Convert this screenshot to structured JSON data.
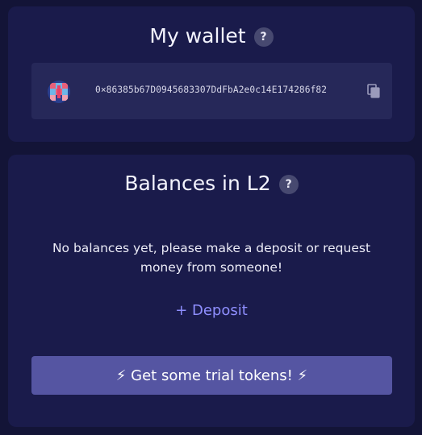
{
  "wallet": {
    "title": "My wallet",
    "help_glyph": "?",
    "address": "0×86385b67D0945683307DdFbA2e0c14E174286f82",
    "avatar_icon": "blockie-avatar-icon",
    "copy_icon": "copy-icon"
  },
  "balances": {
    "title": "Balances in L2",
    "help_glyph": "?",
    "empty_message": "No balances yet, please make a deposit or request money from someone!",
    "deposit_label": "+ Deposit",
    "trial_button_label": "⚡ Get some trial tokens! ⚡"
  },
  "colors": {
    "page_background": "#131437",
    "card_background": "#1a1b4b",
    "address_box": "#262859",
    "help_icon": "#474970",
    "accent_link": "#8f8fff",
    "button": "#5555a2"
  }
}
